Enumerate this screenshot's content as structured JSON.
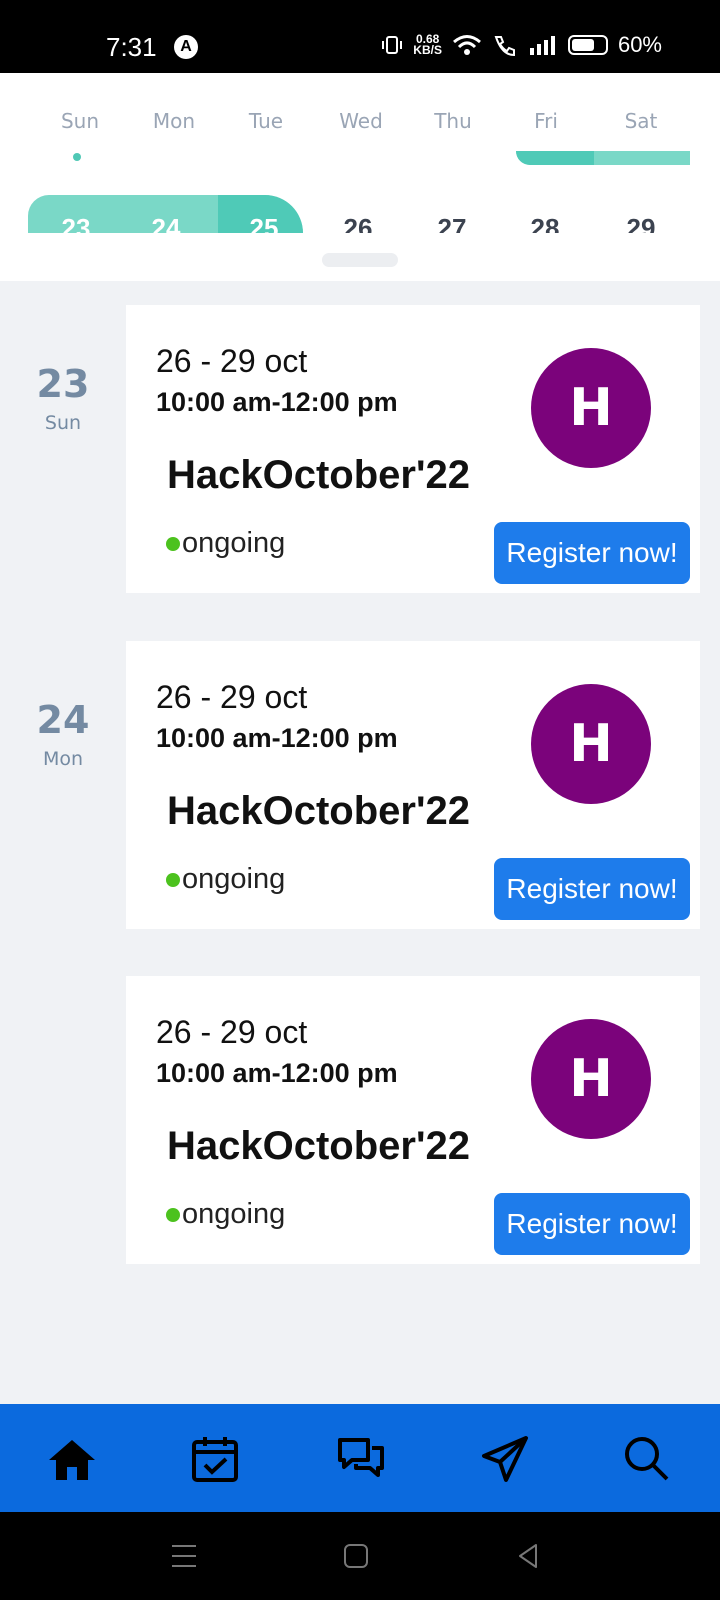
{
  "status_bar": {
    "time": "7:31",
    "app_icon": "A",
    "net_speed_value": "0.68",
    "net_speed_unit": "KB/S",
    "battery": "60%"
  },
  "calendar": {
    "weekdays": [
      "Sun",
      "Mon",
      "Tue",
      "Wed",
      "Thu",
      "Fri",
      "Sat"
    ],
    "dates": [
      "23",
      "24",
      "25",
      "26",
      "27",
      "28",
      "29"
    ],
    "accent_color": "#4fcab7",
    "range_color": "#7ad8c7"
  },
  "day_groups": [
    {
      "day_num": "23",
      "day_name": "Sun"
    },
    {
      "day_num": "24",
      "day_name": "Mon"
    }
  ],
  "events": [
    {
      "dates": "26 - 29 oct",
      "time": "10:00 am-12:00 pm",
      "title": "HackOctober'22",
      "status": "ongoing",
      "logo_letter": "H",
      "register_label": "Register now!"
    },
    {
      "dates": "26 - 29 oct",
      "time": "10:00 am-12:00 pm",
      "title": "HackOctober'22",
      "status": "ongoing",
      "logo_letter": "H",
      "register_label": "Register now!"
    },
    {
      "dates": "26 - 29 oct",
      "time": "10:00 am-12:00 pm",
      "title": "HackOctober'22",
      "status": "ongoing",
      "logo_letter": "H",
      "register_label": "Register now!"
    }
  ],
  "bottom_nav": {
    "items": [
      "home-icon",
      "calendar-icon",
      "chat-icon",
      "send-icon",
      "search-icon"
    ],
    "background": "#0b6ade"
  },
  "colors": {
    "logo": "#7b037b",
    "button": "#1e7ceb",
    "status_dot": "#4cc21e"
  }
}
